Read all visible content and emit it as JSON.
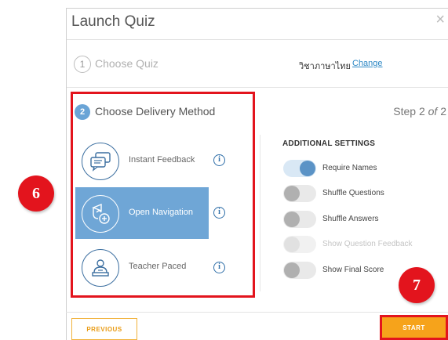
{
  "modal": {
    "title": "Launch Quiz",
    "close_glyph": "×"
  },
  "step1": {
    "number": "1",
    "label": "Choose Quiz",
    "quiz_name": "วิชาภาษาไทย",
    "change_link": "Change"
  },
  "step2": {
    "number": "2",
    "label": "Choose Delivery Method",
    "step_prefix": "Step 2 ",
    "step_of": "of",
    "step_total": " 2"
  },
  "methods": [
    {
      "label": "Instant Feedback",
      "icon": "chat-bubbles-icon",
      "selected": false
    },
    {
      "label": "Open Navigation",
      "icon": "navigation-add-icon",
      "selected": true
    },
    {
      "label": "Teacher Paced",
      "icon": "teacher-icon",
      "selected": false
    }
  ],
  "info_glyph": "i",
  "additional": {
    "title": "ADDITIONAL SETTINGS",
    "settings": [
      {
        "label": "Require Names",
        "on": true,
        "disabled": false
      },
      {
        "label": "Shuffle Questions",
        "on": false,
        "disabled": false
      },
      {
        "label": "Shuffle Answers",
        "on": false,
        "disabled": false
      },
      {
        "label": "Show Question Feedback",
        "on": false,
        "disabled": true
      },
      {
        "label": "Show Final Score",
        "on": false,
        "disabled": false
      }
    ]
  },
  "footer": {
    "previous_label": "PREVIOUS",
    "start_label": "START"
  },
  "callouts": {
    "six": "6",
    "seven": "7"
  },
  "colors": {
    "accent_blue": "#6fa6d6",
    "icon_blue": "#3c6fa0",
    "highlight_red": "#e3141d",
    "start_orange": "#f6a31b"
  }
}
